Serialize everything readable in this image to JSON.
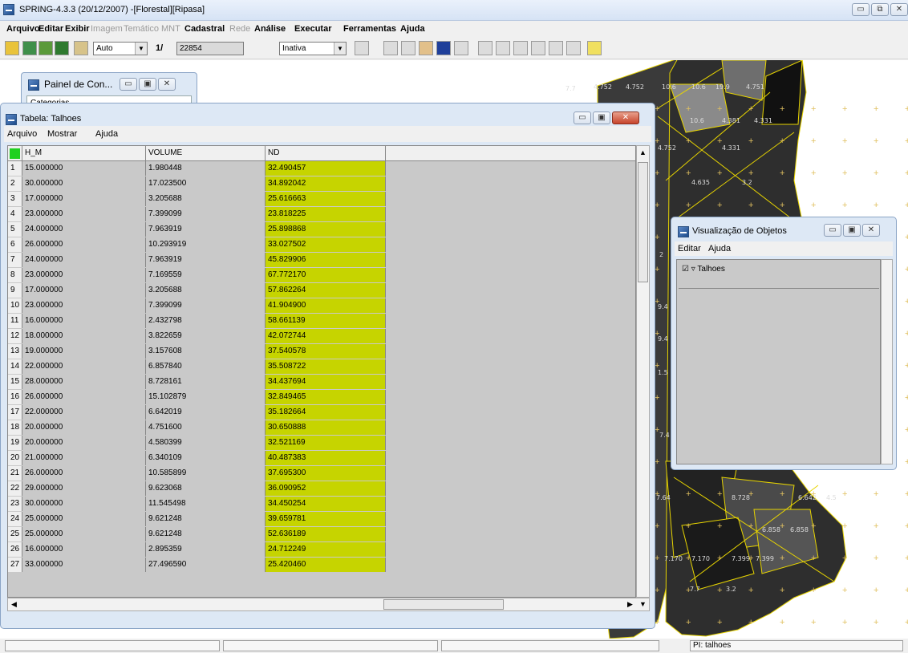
{
  "app": {
    "title": "SPRING-4.3.3 (20/12/2007) -[Florestal][Ripasa]"
  },
  "menu": {
    "items": [
      {
        "label": "Arquivo",
        "enabled": true
      },
      {
        "label": "Editar",
        "enabled": true
      },
      {
        "label": "Exibir",
        "enabled": true
      },
      {
        "label": "Imagem",
        "enabled": false
      },
      {
        "label": "Temático",
        "enabled": false
      },
      {
        "label": "MNT",
        "enabled": false
      },
      {
        "label": "Cadastral",
        "enabled": true
      },
      {
        "label": "Rede",
        "enabled": false
      },
      {
        "label": "Análise",
        "enabled": true
      },
      {
        "label": "Executar",
        "enabled": true
      },
      {
        "label": "Ferramentas",
        "enabled": true
      },
      {
        "label": "Ajuda",
        "enabled": true
      }
    ]
  },
  "toolbar": {
    "mode_value": "Auto",
    "scale_prefix": "1/",
    "scale_value": "22854",
    "state_value": "Inativa"
  },
  "panel": {
    "title": "Painel de Con...",
    "content": "Categorias"
  },
  "table_window": {
    "title": "Tabela: Talhoes",
    "menu": [
      "Arquivo",
      "Mostrar",
      "Ajuda"
    ],
    "columns": [
      "H_M",
      "VOLUME",
      "ND",
      ""
    ],
    "rows": [
      {
        "n": "1",
        "h": "15.000000",
        "v": "1.980448",
        "nd": "32.490457"
      },
      {
        "n": "2",
        "h": "30.000000",
        "v": "17.023500",
        "nd": "34.892042"
      },
      {
        "n": "3",
        "h": "17.000000",
        "v": "3.205688",
        "nd": "25.616663"
      },
      {
        "n": "4",
        "h": "23.000000",
        "v": "7.399099",
        "nd": "23.818225"
      },
      {
        "n": "5",
        "h": "24.000000",
        "v": "7.963919",
        "nd": "25.898868"
      },
      {
        "n": "6",
        "h": "26.000000",
        "v": "10.293919",
        "nd": "33.027502"
      },
      {
        "n": "7",
        "h": "24.000000",
        "v": "7.963919",
        "nd": "45.829906"
      },
      {
        "n": "8",
        "h": "23.000000",
        "v": "7.169559",
        "nd": "67.772170"
      },
      {
        "n": "9",
        "h": "17.000000",
        "v": "3.205688",
        "nd": "57.862264"
      },
      {
        "n": "10",
        "h": "23.000000",
        "v": "7.399099",
        "nd": "41.904900"
      },
      {
        "n": "11",
        "h": "16.000000",
        "v": "2.432798",
        "nd": "58.661139"
      },
      {
        "n": "12",
        "h": "18.000000",
        "v": "3.822659",
        "nd": "42.072744"
      },
      {
        "n": "13",
        "h": "19.000000",
        "v": "3.157608",
        "nd": "37.540578"
      },
      {
        "n": "14",
        "h": "22.000000",
        "v": "6.857840",
        "nd": "35.508722"
      },
      {
        "n": "15",
        "h": "28.000000",
        "v": "8.728161",
        "nd": "34.437694"
      },
      {
        "n": "16",
        "h": "26.000000",
        "v": "15.102879",
        "nd": "32.849465"
      },
      {
        "n": "17",
        "h": "22.000000",
        "v": "6.642019",
        "nd": "35.182664"
      },
      {
        "n": "18",
        "h": "20.000000",
        "v": "4.751600",
        "nd": "30.650888"
      },
      {
        "n": "19",
        "h": "20.000000",
        "v": "4.580399",
        "nd": "32.521169"
      },
      {
        "n": "20",
        "h": "21.000000",
        "v": "6.340109",
        "nd": "40.487383"
      },
      {
        "n": "21",
        "h": "26.000000",
        "v": "10.585899",
        "nd": "37.695300"
      },
      {
        "n": "22",
        "h": "29.000000",
        "v": "9.623068",
        "nd": "36.090952"
      },
      {
        "n": "23",
        "h": "30.000000",
        "v": "11.545498",
        "nd": "34.450254"
      },
      {
        "n": "24",
        "h": "25.000000",
        "v": "9.621248",
        "nd": "39.659781"
      },
      {
        "n": "25",
        "h": "25.000000",
        "v": "9.621248",
        "nd": "52.636189"
      },
      {
        "n": "26",
        "h": "16.000000",
        "v": "2.895359",
        "nd": "24.712249"
      },
      {
        "n": "27",
        "h": "33.000000",
        "v": "27.496590",
        "nd": "25.420460"
      }
    ]
  },
  "viz_window": {
    "title": "Visualização de Objetos",
    "menu": [
      "Editar",
      "Ajuda"
    ],
    "item_label": "Talhoes"
  },
  "map_labels": [
    "7.7",
    "4.752",
    "4.752",
    "10.6",
    "10.6",
    "19.9",
    "4.751",
    "10.6",
    "4.381",
    "4.331",
    "4.752",
    "4.331",
    "4.635",
    "3.2",
    "7.64",
    "8.728",
    "6.642",
    "4.5",
    "6.858",
    "6.858",
    "7.170",
    "7.170",
    "7.399",
    "7.399",
    "7.7",
    "3.2",
    "2",
    "9.4",
    "9.4",
    "1.5",
    "7.4"
  ],
  "status": {
    "pi_label": "PI: talhoes"
  },
  "colors": {
    "nd_column": "#c6d400",
    "corner_marker": "#1fd01f",
    "polygon_border": "#e7d400"
  }
}
